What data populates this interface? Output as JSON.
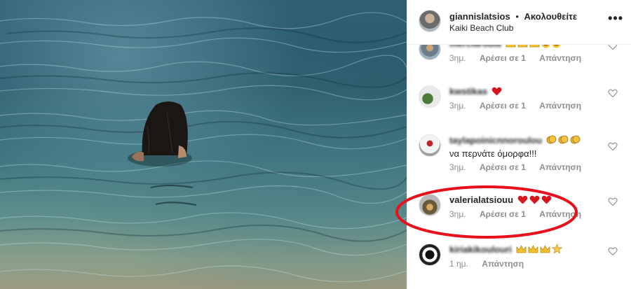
{
  "header": {
    "username": "giannislatsios",
    "separator": "•",
    "follow_label": "Ακολουθείτε",
    "location": "Kaiki Beach Club",
    "more_icon": "more-horizontal-icon",
    "more_glyph": "•••"
  },
  "comments": [
    {
      "username": "merciaroula",
      "text": "",
      "emojis": [
        "crown",
        "crown",
        "crown",
        "smile",
        "smile"
      ],
      "time": "3ημ.",
      "likes": "Αρέσει σε 1",
      "reply": "Απάντηση",
      "blurred": true
    },
    {
      "username": "kwstikas",
      "text": "",
      "emojis": [
        "heart"
      ],
      "time": "3ημ.",
      "likes": "Αρέσει σε 1",
      "reply": "Απάντηση",
      "blurred": true
    },
    {
      "username": "taylapoinicnnoroulou",
      "text": "να περνάτε όμορφα!!!",
      "emojis": [
        "clap",
        "clap",
        "clap"
      ],
      "time": "3ημ.",
      "likes": "Αρέσει σε 1",
      "reply": "Απάντηση",
      "blurred": true
    },
    {
      "username": "valerialatsiouu",
      "text": "",
      "emojis": [
        "heart",
        "heart",
        "heart"
      ],
      "time": "3ημ.",
      "likes": "Αρέσει σε 1",
      "reply": "Απάντηση",
      "blurred": false
    },
    {
      "username": "kiriakikoulouri",
      "text": "",
      "emojis": [
        "crown",
        "crown",
        "crown",
        "star"
      ],
      "time": "1 ημ.",
      "likes": "",
      "reply": "Απάντηση",
      "blurred": true
    }
  ],
  "colors": {
    "highlight": "#e8101a",
    "heart": "#d8151d",
    "crown": "#f2c230",
    "meta": "#8e8e8e",
    "text": "#262626"
  }
}
